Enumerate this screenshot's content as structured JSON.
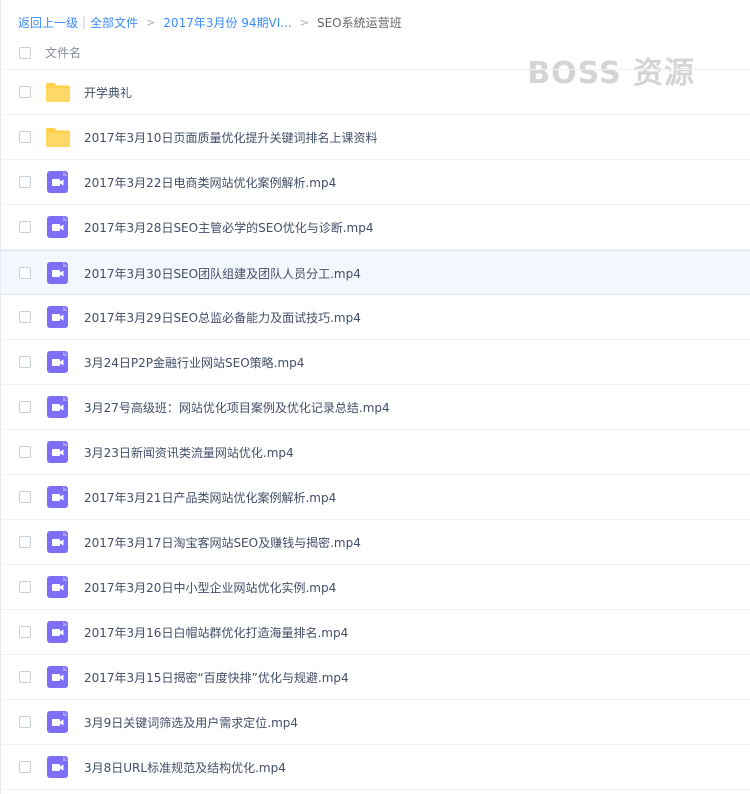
{
  "breadcrumb": {
    "back": "返回上一级",
    "sep": "|",
    "all_files": "全部文件",
    "arrow": ">",
    "folder": "2017年3月份 94期VI...",
    "current": "SEO系统运营班"
  },
  "watermark": "BOSS 资源",
  "header": {
    "column_name": "文件名"
  },
  "files": [
    {
      "name": "开学典礼",
      "type": "folder"
    },
    {
      "name": "2017年3月10日页面质量优化提升关键词排名上课资料",
      "type": "folder"
    },
    {
      "name": "2017年3月22日电商类网站优化案例解析.mp4",
      "type": "video"
    },
    {
      "name": "2017年3月28日SEO主管必学的SEO优化与诊断.mp4",
      "type": "video"
    },
    {
      "name": "2017年3月30日SEO团队组建及团队人员分工.mp4",
      "type": "video",
      "hover": true
    },
    {
      "name": "2017年3月29日SEO总监必备能力及面试技巧.mp4",
      "type": "video"
    },
    {
      "name": "3月24日P2P金融行业网站SEO策略.mp4",
      "type": "video"
    },
    {
      "name": "3月27号高级班：网站优化项目案例及优化记录总结.mp4",
      "type": "video"
    },
    {
      "name": "3月23日新闻资讯类流量网站优化.mp4",
      "type": "video"
    },
    {
      "name": "2017年3月21日产品类网站优化案例解析.mp4",
      "type": "video"
    },
    {
      "name": "2017年3月17日淘宝客网站SEO及赚钱与揭密.mp4",
      "type": "video"
    },
    {
      "name": "2017年3月20日中小型企业网站优化实例.mp4",
      "type": "video"
    },
    {
      "name": "2017年3月16日白帽站群优化打造海量排名.mp4",
      "type": "video"
    },
    {
      "name": "2017年3月15日揭密“百度快排”优化与规避.mp4",
      "type": "video"
    },
    {
      "name": "3月9日关键词筛选及用户需求定位.mp4",
      "type": "video"
    },
    {
      "name": "3月8日URL标准规范及结构优化.mp4",
      "type": "video"
    }
  ],
  "colors": {
    "link": "#3b8cff",
    "folder": "#ffcf4d",
    "video": "#7d6ef5",
    "hover_row": "#f3f8fe"
  },
  "icons": {
    "folder": "folder-icon",
    "video": "video-file-icon"
  }
}
